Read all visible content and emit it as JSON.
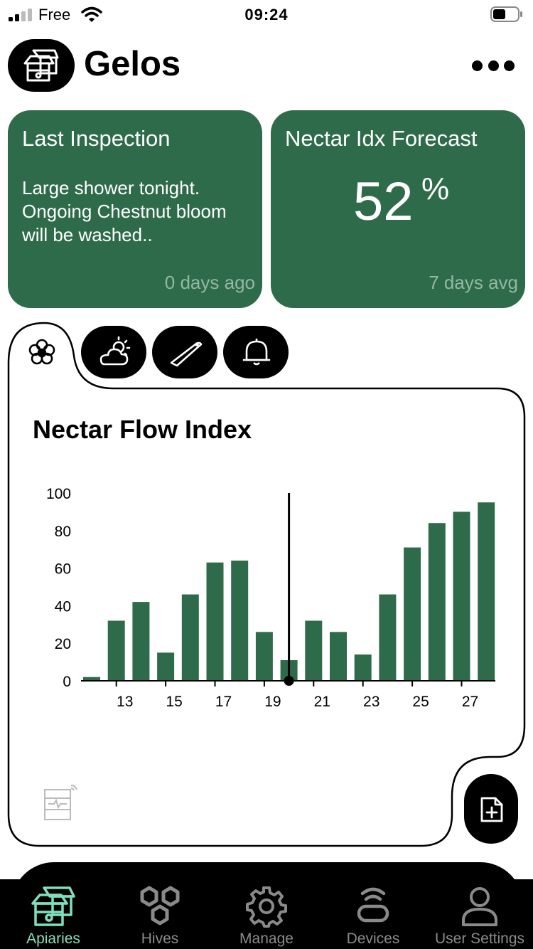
{
  "status_bar": {
    "carrier": "Free",
    "time": "09:24"
  },
  "header": {
    "title": "Gelos"
  },
  "cards": {
    "inspection": {
      "title": "Last Inspection",
      "body": "Large shower tonight. Ongoing Chestnut bloom will be washed..",
      "footer": "0 days ago"
    },
    "forecast": {
      "title": "Nectar Idx Forecast",
      "value": "52",
      "unit": "%",
      "footer": "7 days avg"
    }
  },
  "chart_title": "Nectar Flow Index",
  "chart_data": {
    "type": "bar",
    "title": "Nectar Flow Index",
    "x": [
      12,
      13,
      14,
      15,
      16,
      17,
      18,
      19,
      20,
      21,
      22,
      23,
      24,
      25,
      26,
      27,
      28
    ],
    "values": [
      2,
      32,
      42,
      15,
      46,
      63,
      64,
      26,
      11,
      32,
      26,
      14,
      46,
      71,
      84,
      90,
      95
    ],
    "x_tick_labels": [
      "13",
      "15",
      "17",
      "19",
      "21",
      "23",
      "25",
      "27"
    ],
    "y_ticks": [
      0,
      20,
      40,
      60,
      80,
      100
    ],
    "ylim": [
      0,
      100
    ],
    "marker_x": 20,
    "grid": false,
    "bar_color": "#2e6b4b"
  },
  "nav": {
    "items": [
      {
        "label": "Apiaries",
        "icon": "apiary-icon",
        "active": true
      },
      {
        "label": "Hives",
        "icon": "honeycomb-icon",
        "active": false
      },
      {
        "label": "Manage",
        "icon": "gear-icon",
        "active": false
      },
      {
        "label": "Devices",
        "icon": "device-icon",
        "active": false
      },
      {
        "label": "User Settings",
        "icon": "user-icon",
        "active": false
      }
    ]
  },
  "colors": {
    "accent": "#2e6b4b",
    "nav_active": "#7fe0c0",
    "nav_inactive": "#8a8a8a"
  }
}
